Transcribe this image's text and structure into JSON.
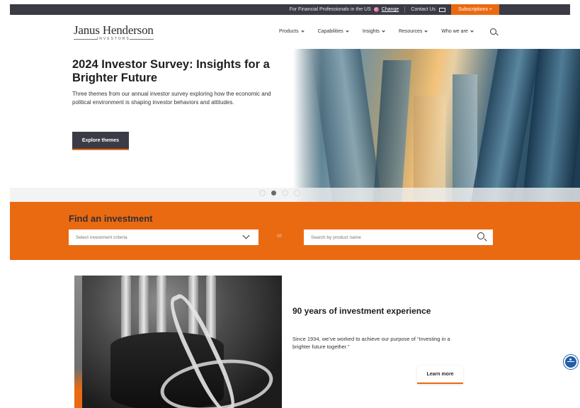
{
  "util_bar": {
    "professionals_text": "For Financial Professionals in the US",
    "change_link": "Change",
    "contact": "Contact Us",
    "subscriptions": "Subscriptions +"
  },
  "header": {
    "logo_name": "Janus Henderson",
    "logo_sub": "INVESTORS",
    "nav": [
      {
        "label": "Products"
      },
      {
        "label": "Capabilities"
      },
      {
        "label": "Insights"
      },
      {
        "label": "Resources"
      },
      {
        "label": "Who we are"
      }
    ]
  },
  "hero": {
    "title": "2024 Investor Survey: Insights for a Brighter Future",
    "description": "Three themes from our annual investor survey exploring how the economic and political environment is shaping investor behaviors and attitudes.",
    "button": "Explore themes",
    "carousel_active_index": 1
  },
  "find": {
    "title": "Find an investment",
    "select_placeholder": "Select investment criteria",
    "or": "or",
    "search_placeholder": "Search by product name"
  },
  "experience": {
    "title": "90 years of investment experience",
    "description": "Since 1934, we’ve worked to achieve our purpose of “Investing in a brighter future together.”",
    "button": "Learn more"
  },
  "colors": {
    "accent": "#ea6a12",
    "dark": "#3a3b44"
  }
}
